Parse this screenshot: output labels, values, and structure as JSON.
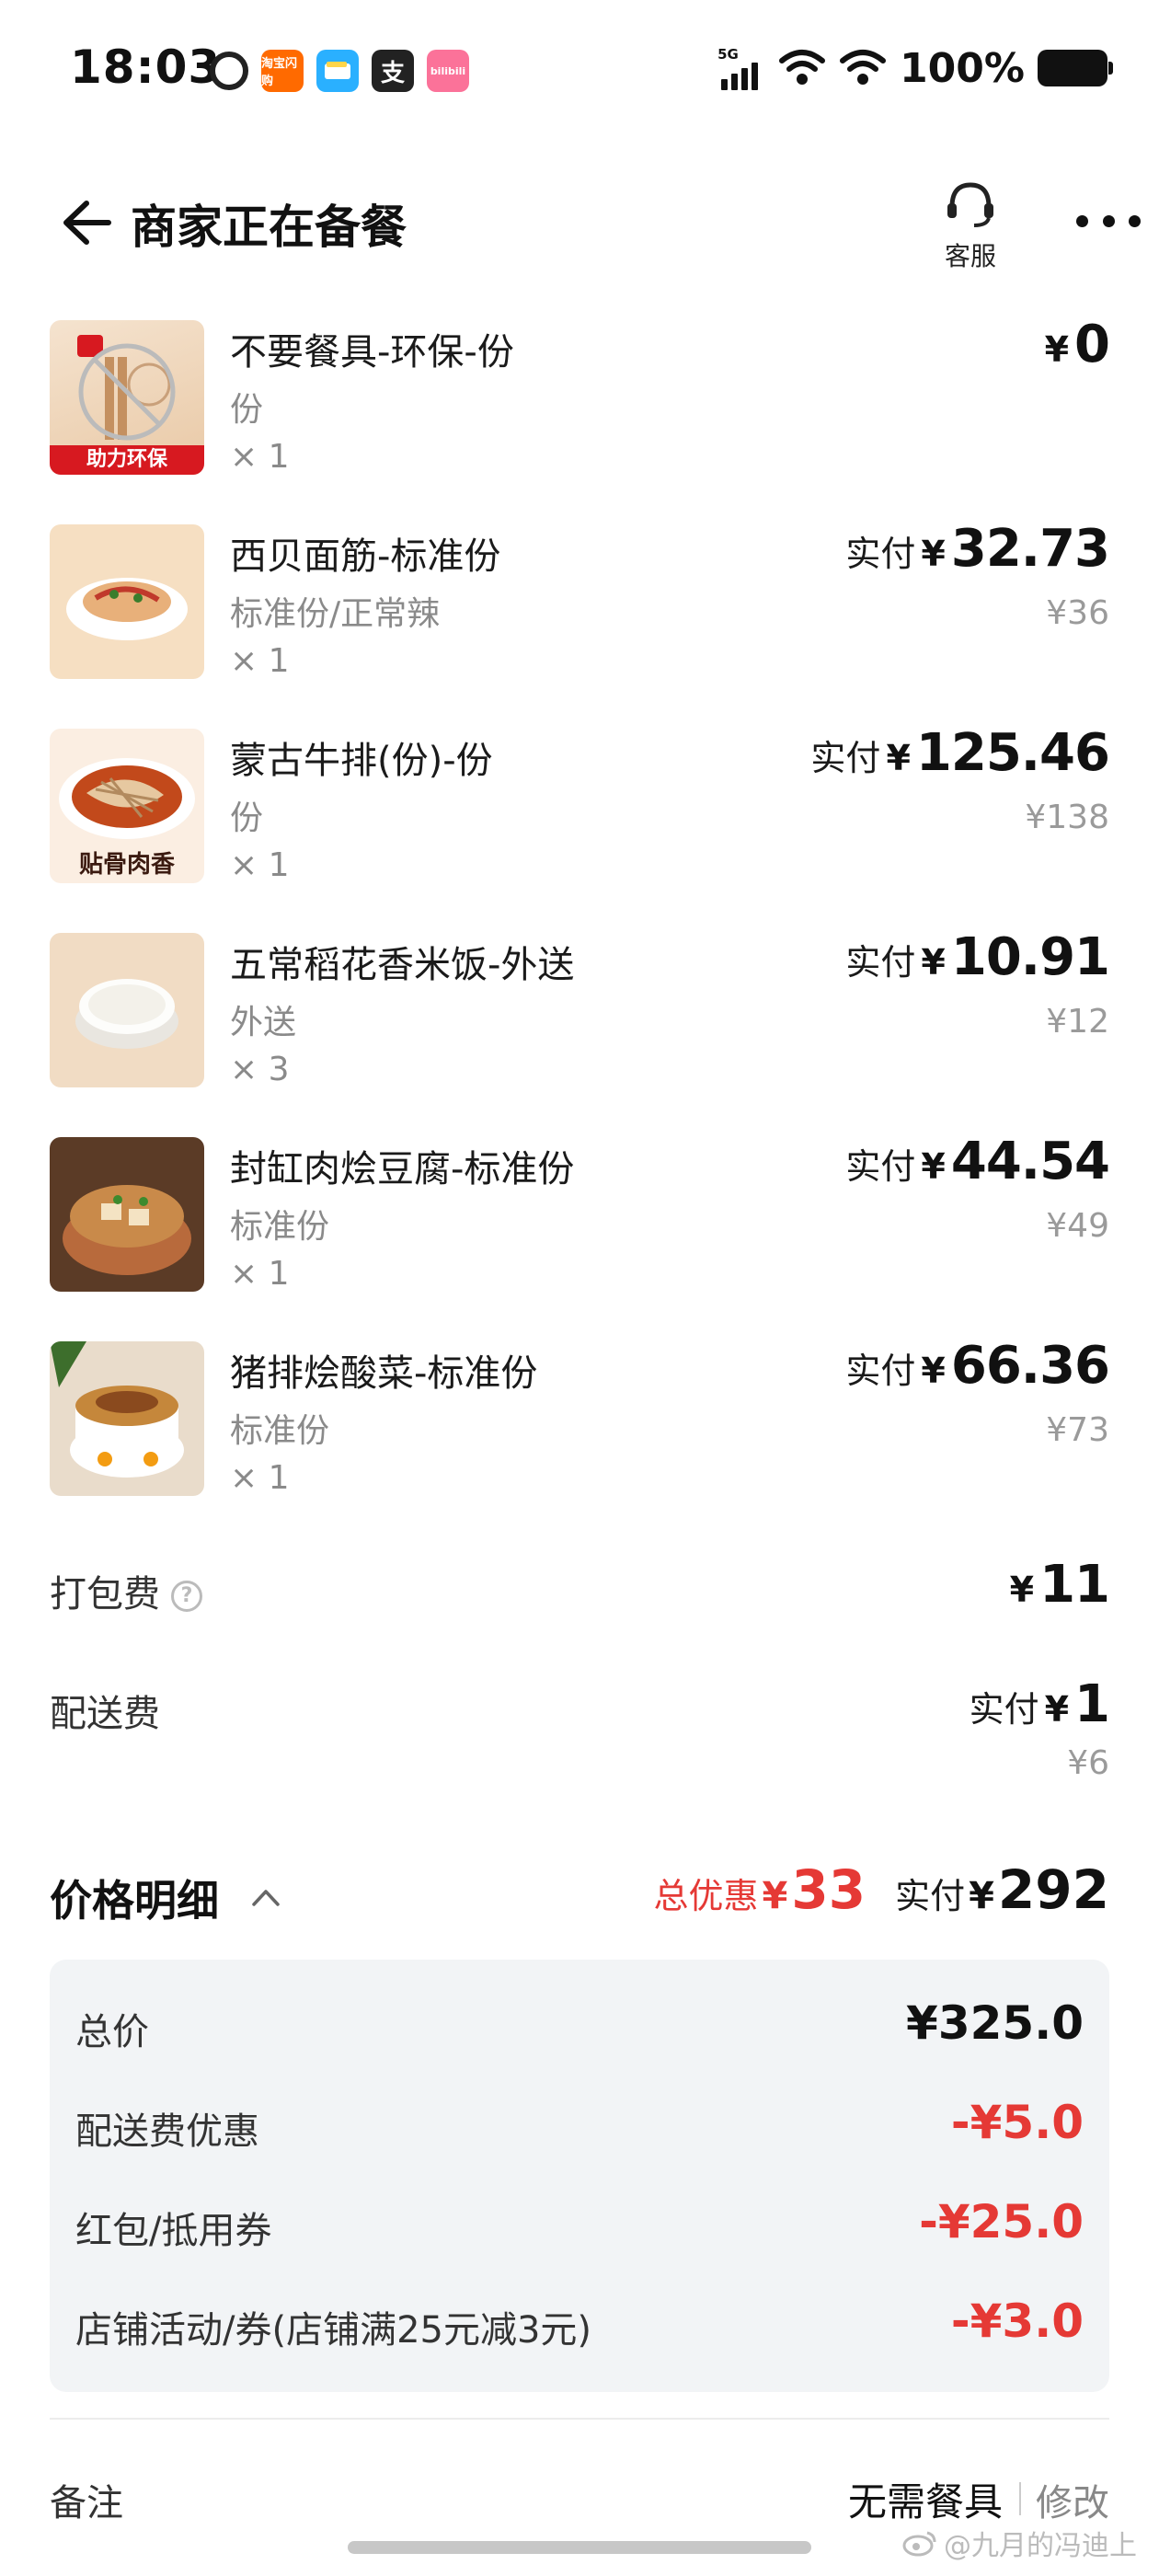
{
  "status_bar": {
    "time": "18:03",
    "network": "5G",
    "battery": "100%",
    "app_icons": [
      {
        "name": "netease-music-icon",
        "text": ""
      },
      {
        "name": "taobao-flash-icon",
        "text": "淘宝闪购"
      },
      {
        "name": "wallet-icon",
        "text": ""
      },
      {
        "name": "alipay-icon",
        "text": "支"
      },
      {
        "name": "bilibili-icon",
        "text": "bilibili"
      }
    ]
  },
  "header": {
    "title": "商家正在备餐",
    "customer_service_label": "客服"
  },
  "items": [
    {
      "name": "不要餐具-环保-份",
      "spec": "份",
      "qty": "× 1",
      "pay_label": "",
      "yen": "¥",
      "price": "0",
      "original": "",
      "thumb_badge": "助力环保",
      "thumb_caption": ""
    },
    {
      "name": "西贝面筋-标准份",
      "spec": "标准份/正常辣",
      "qty": "× 1",
      "pay_label": "实付",
      "yen": "¥",
      "price": "32.73",
      "original": "¥36",
      "thumb_badge": "",
      "thumb_caption": ""
    },
    {
      "name": "蒙古牛排(份)-份",
      "spec": "份",
      "qty": "× 1",
      "pay_label": "实付",
      "yen": "¥",
      "price": "125.46",
      "original": "¥138",
      "thumb_badge": "",
      "thumb_caption": "贴骨肉香"
    },
    {
      "name": "五常稻花香米饭-外送",
      "spec": "外送",
      "qty": "× 3",
      "pay_label": "实付",
      "yen": "¥",
      "price": "10.91",
      "original": "¥12",
      "thumb_badge": "",
      "thumb_caption": ""
    },
    {
      "name": "封缸肉烩豆腐-标准份",
      "spec": "标准份",
      "qty": "× 1",
      "pay_label": "实付",
      "yen": "¥",
      "price": "44.54",
      "original": "¥49",
      "thumb_badge": "",
      "thumb_caption": ""
    },
    {
      "name": "猪排烩酸菜-标准份",
      "spec": "标准份",
      "qty": "× 1",
      "pay_label": "实付",
      "yen": "¥",
      "price": "66.36",
      "original": "¥73",
      "thumb_badge": "",
      "thumb_caption": ""
    }
  ],
  "fees": {
    "packing": {
      "label": "打包费",
      "yen": "¥",
      "amount": "11"
    },
    "delivery": {
      "label": "配送费",
      "pay_label": "实付",
      "yen": "¥",
      "amount": "1",
      "original": "¥6"
    }
  },
  "price_detail": {
    "title": "价格明细",
    "discount_label": "总优惠",
    "discount_yen": "¥",
    "discount_amount": "33",
    "pay_label": "实付",
    "pay_yen": "¥",
    "pay_amount": "292",
    "lines": [
      {
        "label": "总价",
        "value": "¥325.0",
        "negative": false
      },
      {
        "label": "配送费优惠",
        "value": "-¥5.0",
        "negative": true
      },
      {
        "label": "红包/抵用券",
        "value": "-¥25.0",
        "negative": true
      },
      {
        "label": "店铺活动/券(店铺满25元减3元)",
        "value": "-¥3.0",
        "negative": true
      }
    ]
  },
  "remark": {
    "label": "备注",
    "value": "无需餐具",
    "edit": "修改"
  },
  "watermark": "@九月的冯迪上",
  "colors": {
    "discount_red": "#e53935",
    "badge_red": "#d71920",
    "muted_gray": "#8a8a8a",
    "detail_bg": "#f2f4f6"
  }
}
